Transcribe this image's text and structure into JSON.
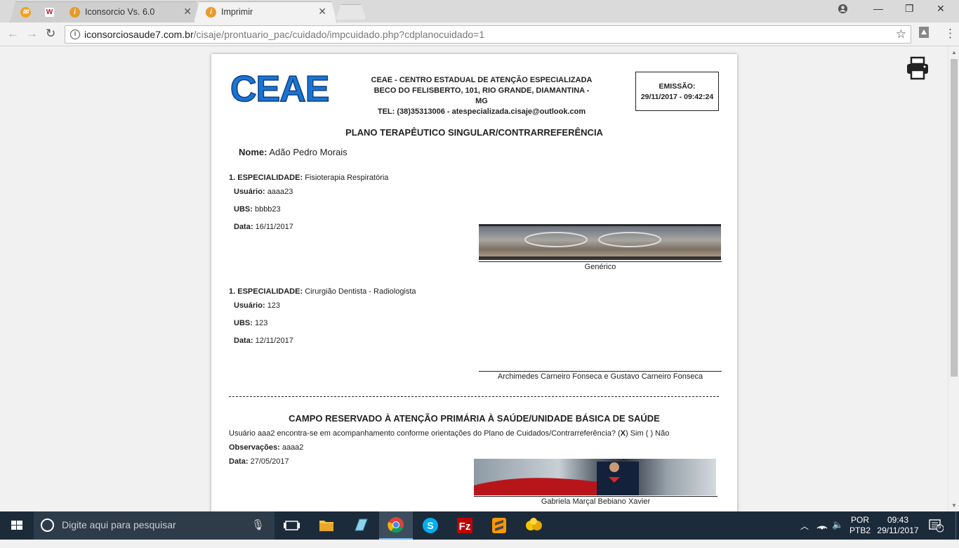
{
  "browser": {
    "tabs": [
      {
        "title": "",
        "icon": "orange-icon"
      },
      {
        "title": "",
        "icon": "w-icon"
      },
      {
        "title": "Iconsorcio Vs. 6.0",
        "icon": "info-icon"
      },
      {
        "title": "Imprimir",
        "icon": "info-icon"
      }
    ],
    "url_host": "iconsorciosaude7.com.br",
    "url_path": "/cisaje/prontuario_pac/cuidado/impcuidado.php?cdplanocuidado=1"
  },
  "header": {
    "logo": "CEAE",
    "org_line1": "CEAE - CENTRO ESTADUAL DE ATENÇÃO ESPECIALIZADA",
    "org_line2": "BECO DO FELISBERTO, 101, RIO GRANDE, DIAMANTINA - MG",
    "org_line3": "TEL: (38)35313006 - atespecializada.cisaje@outlook.com",
    "emission_label": "EMISSÃO:",
    "emission_value": "29/11/2017 - 09:42:24"
  },
  "doc": {
    "title": "PLANO TERAPÊUTICO SINGULAR/CONTRARREFERÊNCIA",
    "nome_label": "Nome:",
    "nome_value": "Adão Pedro Morais",
    "entries": [
      {
        "esp_label": "1. ESPECIALIDADE:",
        "esp_value": "Fisioterapia Respiratória",
        "usuario_label": "Usuário:",
        "usuario_value": "aaaa23",
        "ubs_label": "UBS:",
        "ubs_value": "bbbb23",
        "data_label": "Data:",
        "data_value": "16/11/2017",
        "signature": "Genérico"
      },
      {
        "esp_label": "1. ESPECIALIDADE:",
        "esp_value": "Cirurgião Dentista - Radiologista",
        "usuario_label": "Usuário:",
        "usuario_value": "123",
        "ubs_label": "UBS:",
        "ubs_value": "123",
        "data_label": "Data:",
        "data_value": "12/11/2017",
        "signature": "Archimedes Carneiro Fonseca e Gustavo Carneiro Fonseca"
      }
    ],
    "primary_title": "CAMPO RESERVADO À ATENÇÃO PRIMÁRIA À SAÚDE/UNIDADE BÁSICA DE SAÚDE",
    "primary_text_pre": "Usuário aaa2 encontra-se em acompanhamento conforme orientações do Plano de Cuidados/Contrarreferência? (",
    "primary_text_x": "X",
    "primary_text_post": ") Sim ( ) Não",
    "obs_label": "Observações:",
    "obs_value": "aaaa2",
    "pdata_label": "Data:",
    "pdata_value": "27/05/2017",
    "primary_signature": "Gabriela Marçal Bebiano Xavier"
  },
  "taskbar": {
    "search_placeholder": "Digite aqui para pesquisar",
    "lang1": "POR",
    "lang2": "PTB2",
    "time": "09:43",
    "date": "29/11/2017",
    "notifications": "5"
  }
}
